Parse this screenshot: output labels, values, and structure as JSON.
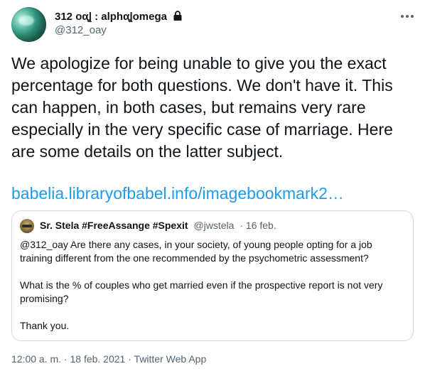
{
  "tweet": {
    "author_name": "312 oαꞲ : alphαꞲomega",
    "author_handle": "@312_oay",
    "text": "We apologize for being unable to give you the exact percentage for both questions. We don't have it. This can happen, in both cases, but remains very rare especially in the very specific case of marriage. Here are some details on the latter subject.",
    "link": "babelia.libraryofbabel.info/imagebookmark2…",
    "timestamp": "12:00 a. m. · 18 feb. 2021",
    "separator": " · ",
    "source": "Twitter Web App"
  },
  "quoted": {
    "author_name": "Sr. Stela #FreeAssange #Spexit",
    "author_handle": "@jwstela",
    "date": "· 16 feb.",
    "paragraphs": [
      "@312_oay Are there any cases, in your society, of young people opting for a job training different from the one recommended by the psychometric assessment?",
      "What is the % of couples who get married even if the prospective report is not very promising?",
      "Thank you."
    ]
  },
  "icons": {
    "lock": "lock-icon",
    "more": "more-options-icon"
  }
}
